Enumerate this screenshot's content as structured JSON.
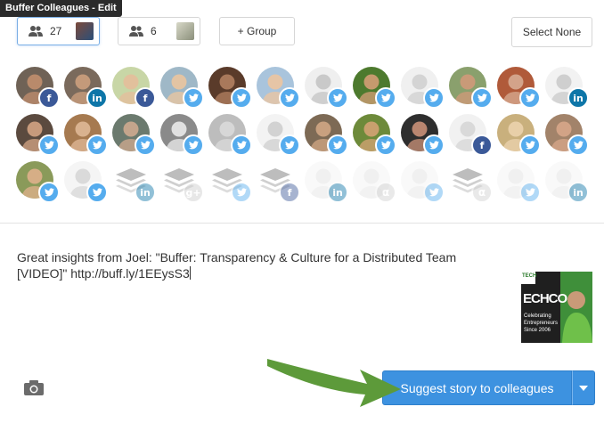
{
  "tooltip": {
    "title": "Buffer Colleagues - Edit"
  },
  "groups": [
    {
      "count": "27",
      "active": true
    },
    {
      "count": "6",
      "active": false
    }
  ],
  "add_group_label": "+ Group",
  "select_none_label": "Select None",
  "network_colors": {
    "facebook": "#3b5998",
    "linkedin": "#0e76a8",
    "twitter": "#55acee",
    "google": "#cccccc",
    "generic": "#cfcfcf"
  },
  "avatar_rows": [
    [
      {
        "kind": "person",
        "network": "facebook",
        "skin": "#b98a6b",
        "bg": "#6f6256"
      },
      {
        "kind": "person",
        "network": "linkedin",
        "skin": "#c49a7a",
        "bg": "#7a6a5c"
      },
      {
        "kind": "person",
        "network": "facebook",
        "skin": "#e2c09c",
        "bg": "#c8d6a6"
      },
      {
        "kind": "person",
        "network": "twitter",
        "skin": "#e3c4a3",
        "bg": "#9fb8c7"
      },
      {
        "kind": "person",
        "network": "twitter",
        "skin": "#a9795b",
        "bg": "#5a3b2a"
      },
      {
        "kind": "person",
        "network": "twitter",
        "skin": "#e6c5a6",
        "bg": "#a9c4dc"
      },
      {
        "kind": "person",
        "network": "twitter",
        "skin": "#c9c9c9",
        "bg": "#efefef"
      },
      {
        "kind": "person",
        "network": "twitter",
        "skin": "#c69a6e",
        "bg": "#4d7a2e"
      },
      {
        "kind": "person",
        "network": "twitter",
        "skin": "#d4d4d4",
        "bg": "#f0f0f0"
      },
      {
        "kind": "person",
        "network": "twitter",
        "skin": "#c99a78",
        "bg": "#8aa06d"
      },
      {
        "kind": "person",
        "network": "twitter",
        "skin": "#d3a38a",
        "bg": "#b05a3a"
      },
      {
        "kind": "person",
        "network": "linkedin",
        "skin": "#cfcfcf",
        "bg": "#f2f2f2"
      }
    ],
    [
      {
        "kind": "person",
        "network": "twitter",
        "skin": "#c79a7c",
        "bg": "#5b4a3f"
      },
      {
        "kind": "person",
        "network": "twitter",
        "skin": "#d9b28f",
        "bg": "#a67a50"
      },
      {
        "kind": "person",
        "network": "twitter",
        "skin": "#c4a58c",
        "bg": "#6b7a6e"
      },
      {
        "kind": "person",
        "network": "twitter",
        "skin": "#e0e0e0",
        "bg": "#8a8a8a"
      },
      {
        "kind": "person",
        "network": "twitter",
        "skin": "#d7d7d7",
        "bg": "#bdbdbd"
      },
      {
        "kind": "person",
        "network": "twitter",
        "skin": "#d2d2d2",
        "bg": "#f3f3f3"
      },
      {
        "kind": "person",
        "network": "twitter",
        "skin": "#c8a07f",
        "bg": "#7d6a55"
      },
      {
        "kind": "person",
        "network": "twitter",
        "skin": "#c9a06e",
        "bg": "#6d8a3a"
      },
      {
        "kind": "person",
        "network": "twitter",
        "skin": "#b98670",
        "bg": "#2e2e2e"
      },
      {
        "kind": "person",
        "network": "facebook",
        "skin": "#d9d9d9",
        "bg": "#f1f1f1"
      },
      {
        "kind": "person",
        "network": "twitter",
        "skin": "#e8cfa8",
        "bg": "#c9b07d"
      },
      {
        "kind": "person",
        "network": "twitter",
        "skin": "#d2a386",
        "bg": "#a2836a"
      }
    ],
    [
      {
        "kind": "person",
        "network": "twitter",
        "skin": "#d6ae86",
        "bg": "#8a9a5a"
      },
      {
        "kind": "person",
        "network": "twitter",
        "skin": "#dadada",
        "bg": "#f5f5f5"
      },
      {
        "kind": "buffer",
        "network": "linkedin",
        "dim": true
      },
      {
        "kind": "buffer",
        "network": "google",
        "dim": true
      },
      {
        "kind": "buffer",
        "network": "twitter",
        "dim": true
      },
      {
        "kind": "buffer",
        "network": "facebook",
        "dim": true
      },
      {
        "kind": "person",
        "network": "linkedin",
        "skin": "#d7d7d7",
        "bg": "#efefef",
        "dim": true
      },
      {
        "kind": "person",
        "network": "generic",
        "skin": "#d7d7d7",
        "bg": "#efefef",
        "dim": true
      },
      {
        "kind": "person",
        "network": "twitter",
        "skin": "#d7d7d7",
        "bg": "#efefef",
        "dim": true
      },
      {
        "kind": "buffer",
        "network": "generic",
        "dim": true
      },
      {
        "kind": "person",
        "network": "twitter",
        "skin": "#d7d7d7",
        "bg": "#efefef",
        "dim": true
      },
      {
        "kind": "person",
        "network": "linkedin",
        "skin": "#d7d7d7",
        "bg": "#efefef",
        "dim": true
      }
    ]
  ],
  "composer": {
    "text": "Great insights from Joel: \"Buffer: Transparency & Culture for a Distributed Team [VIDEO]\" http://buff.ly/1EEysS3"
  },
  "thumbnail": {
    "brand": "ECHCO",
    "tagline": "Celebrating Entrepreneurs Since 2006",
    "badge": "TECH"
  },
  "suggest_label": "Suggest story to colleagues",
  "annotation_arrow_color": "#5d9a3a"
}
